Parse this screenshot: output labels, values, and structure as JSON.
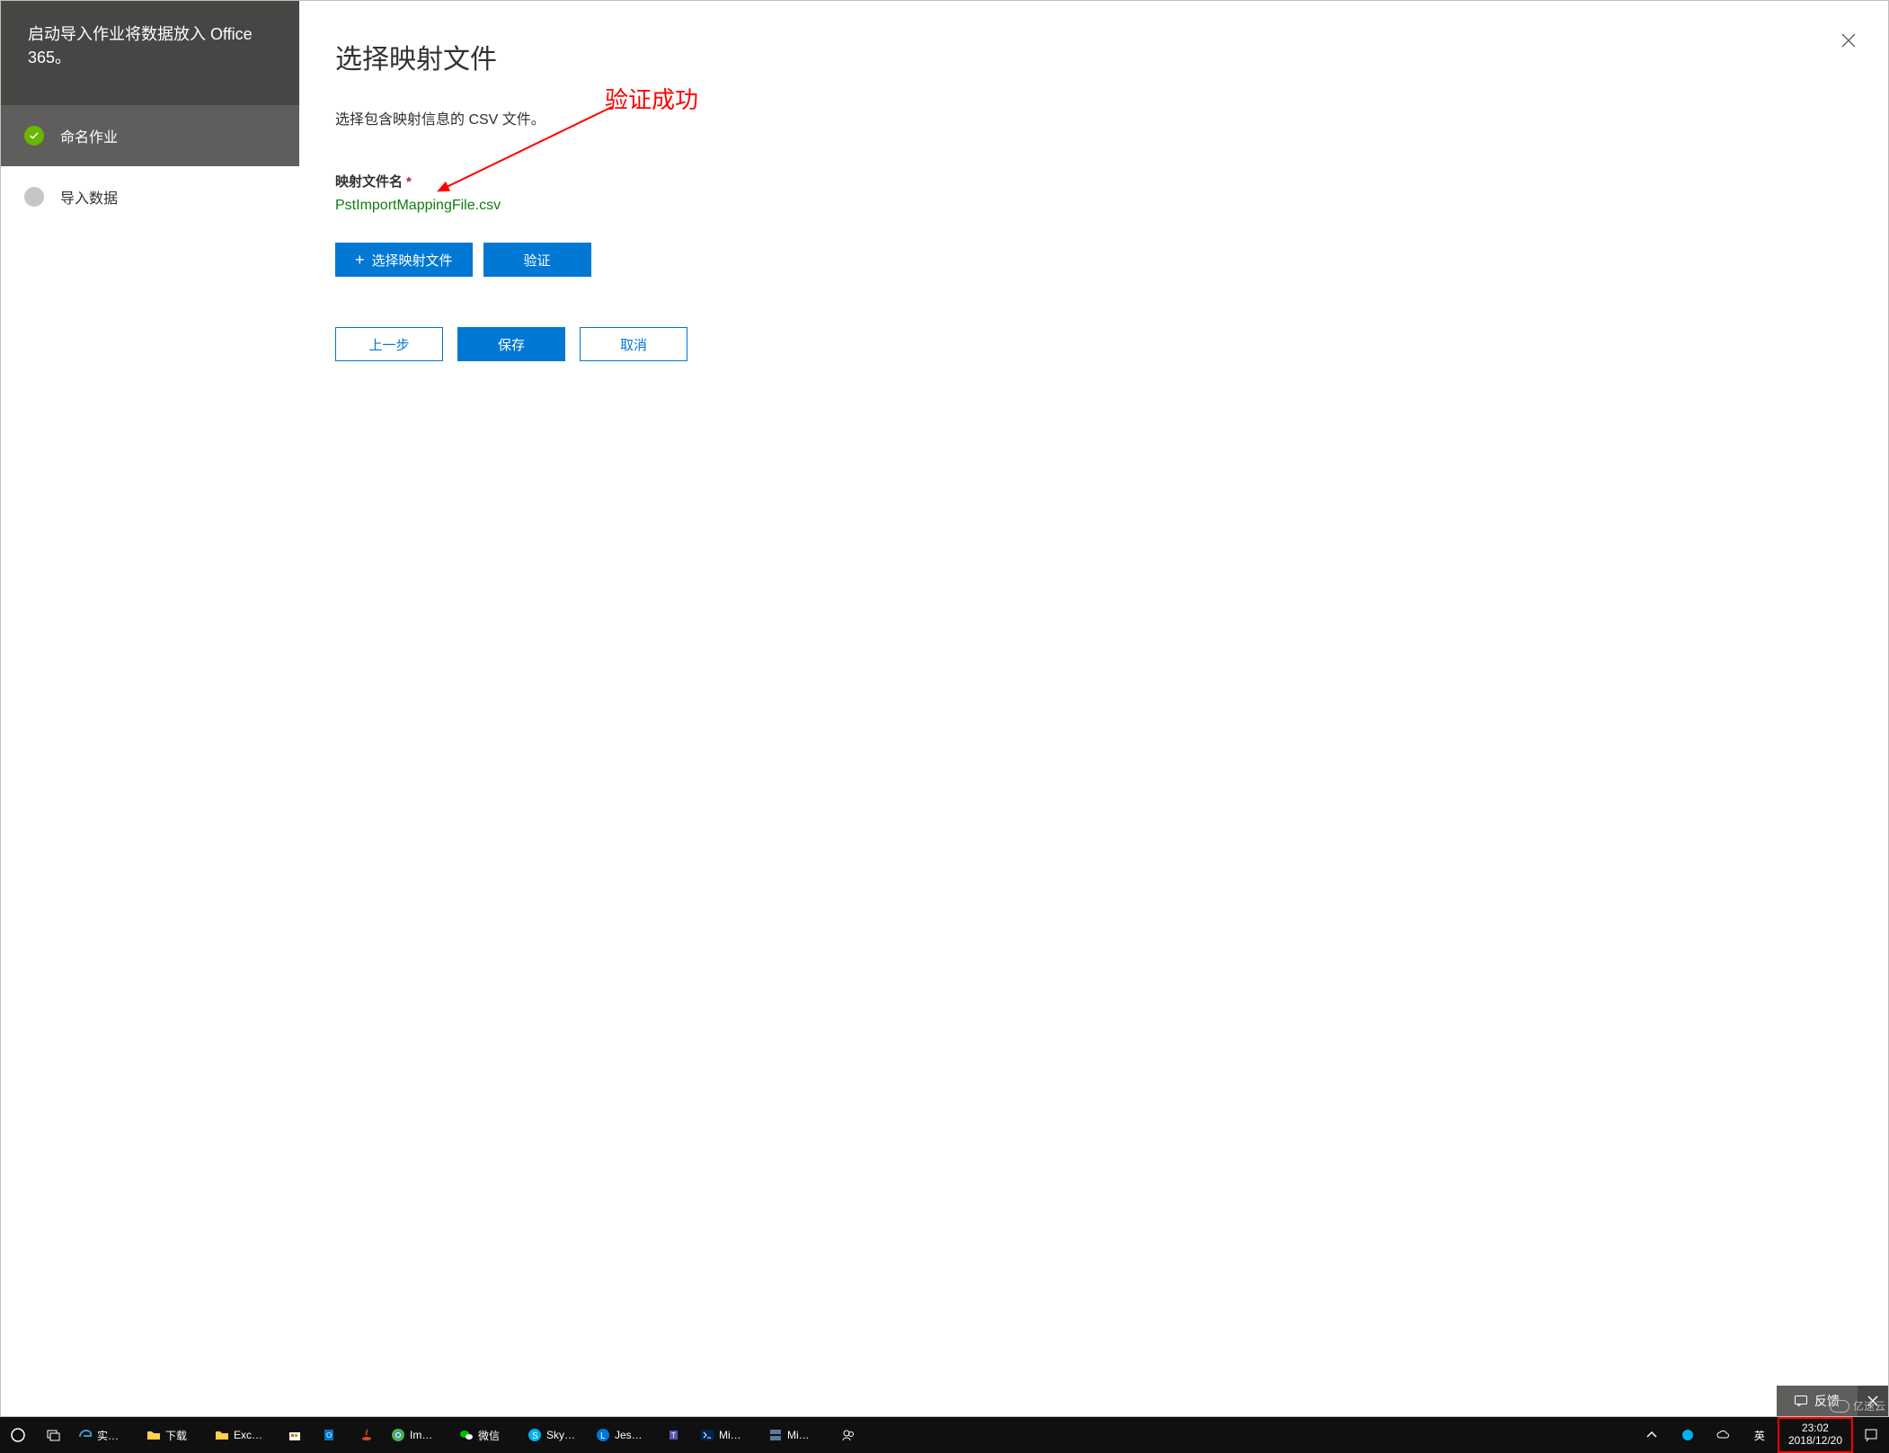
{
  "sidebar": {
    "header": "启动导入作业将数据放入 Office 365。",
    "steps": [
      {
        "label": "命名作业",
        "state": "done"
      },
      {
        "label": "导入数据",
        "state": "current"
      }
    ]
  },
  "main": {
    "title": "选择映射文件",
    "description": "选择包含映射信息的 CSV 文件。",
    "field_label": "映射文件名",
    "required_mark": "*",
    "file_value": "PstImportMappingFile.csv",
    "select_button": "选择映射文件",
    "validate_button": "验证",
    "back_button": "上一步",
    "save_button": "保存",
    "cancel_button": "取消"
  },
  "annotation": {
    "text": "验证成功"
  },
  "feedback": {
    "label": "反馈"
  },
  "taskbar": {
    "items": [
      {
        "name": "cortana",
        "label": ""
      },
      {
        "name": "taskview",
        "label": ""
      },
      {
        "name": "edge",
        "label": "实…"
      },
      {
        "name": "explorer",
        "label": "下载"
      },
      {
        "name": "explorer2",
        "label": "Exc…"
      },
      {
        "name": "store",
        "label": ""
      },
      {
        "name": "outlook",
        "label": ""
      },
      {
        "name": "java",
        "label": ""
      },
      {
        "name": "chrome",
        "label": "Im…"
      },
      {
        "name": "wechat",
        "label": "微信"
      },
      {
        "name": "skype",
        "label": "Sky…"
      },
      {
        "name": "lync",
        "label": "Jes…"
      },
      {
        "name": "teams",
        "label": ""
      },
      {
        "name": "powershell",
        "label": "Mi…"
      },
      {
        "name": "servermgr",
        "label": "Mi…"
      },
      {
        "name": "people",
        "label": ""
      }
    ],
    "tray": {
      "ime": "英",
      "time": "23:02",
      "date": "2018/12/20"
    }
  },
  "watermark": "亿速云"
}
